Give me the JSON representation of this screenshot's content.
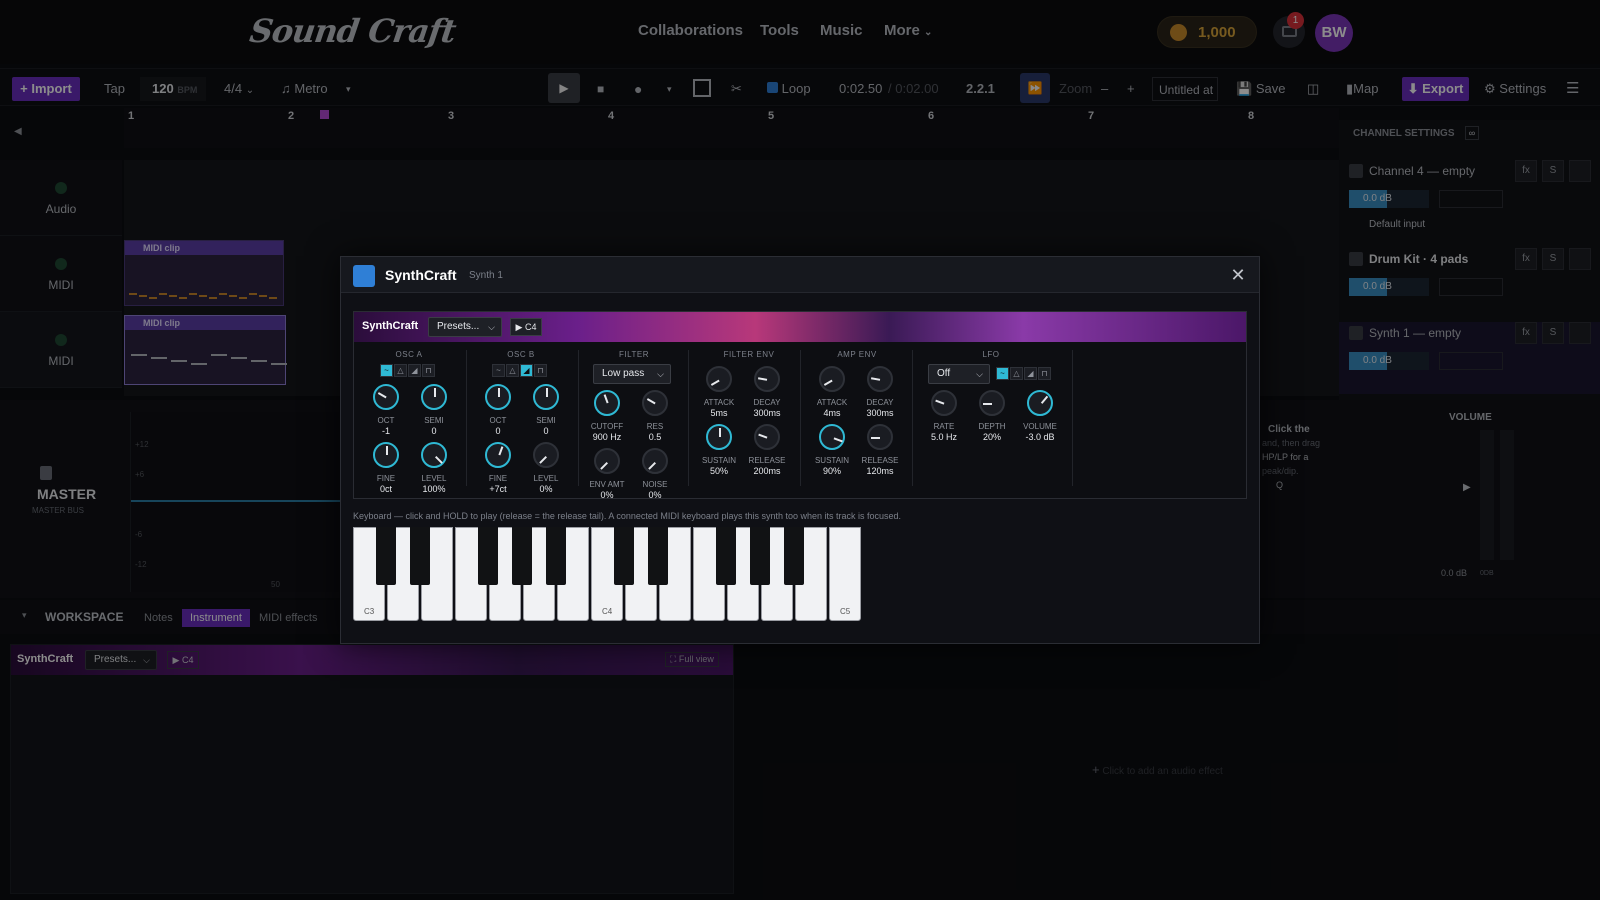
{
  "app": {
    "logo": "Sound Craft"
  },
  "nav": {
    "links": [
      "Collaborations",
      "Tools",
      "Music",
      "More"
    ],
    "more_chevron": "chevron-down-icon"
  },
  "user": {
    "coins": "1,000",
    "notifications": "1",
    "initials": "BW"
  },
  "toolbar": {
    "import": "+ Import",
    "tap": "Tap",
    "bpm": "120",
    "bpm_unit": "BPM",
    "time_sig": "4/4",
    "metro": "Metro",
    "loop": "Loop",
    "position": "0:02.50",
    "duration": "/ 0:02.00",
    "bar_pos": "2.2.1",
    "zoom": "Zoom",
    "zoom_minus": "–",
    "zoom_plus": "+",
    "project_name": "Untitled at",
    "save": "Save",
    "map": "Map",
    "export": "⬇ Export",
    "settings": "Settings"
  },
  "ruler": {
    "bars": [
      "1",
      "2",
      "3",
      "4",
      "5",
      "6",
      "7",
      "8"
    ]
  },
  "tracks": [
    {
      "name": "Audio"
    },
    {
      "name": "MIDI",
      "clip": "MIDI clip"
    },
    {
      "name": "MIDI",
      "clip": "MIDI clip"
    }
  ],
  "channel_settings": {
    "title": "CHANNEL SETTINGS",
    "channels": [
      {
        "name": "Channel 4 — empty",
        "db": "0.0 dB",
        "input": "Default input"
      },
      {
        "name": "Drum Kit · 4 pads",
        "db": "0.0 dB"
      },
      {
        "name": "Synth 1 — empty",
        "db": "0.0 dB"
      }
    ],
    "fx": "fx",
    "solo": "S",
    "colors": {
      "db_fill": "#3a8fc4"
    }
  },
  "master": {
    "name": "MASTER",
    "sub": "MASTER BUS",
    "db_ticks": [
      "+12",
      "+6",
      "0",
      "-6",
      "-12"
    ],
    "ruler_mark": "50",
    "volume_label": "VOLUME",
    "volume_ticks": [
      "+12",
      "+6",
      "0",
      "-6",
      "-12"
    ],
    "volume_db": "0.0 dB",
    "volume_db2": "0DB",
    "hint_title": "Click the",
    "hint_lines": [
      "and, then drag",
      "HP/LP for a",
      "peak/dip.",
      "Q"
    ]
  },
  "workspace": {
    "title": "WORKSPACE",
    "tabs": [
      "Notes",
      "Instrument",
      "MIDI effects"
    ],
    "active_tab": "Instrument",
    "add_effect": "Click to add an audio effect",
    "full_view": "Full view"
  },
  "modal": {
    "title": "SynthCraft",
    "subtitle": "Synth 1",
    "brand": "SynthCraft",
    "presets": "Presets...",
    "play": "▶ C4",
    "sections": {
      "osc_a": "OSC A",
      "osc_b": "OSC B",
      "filter": "FILTER",
      "filter_env": "FILTER ENV",
      "amp_env": "AMP ENV",
      "lfo": "LFO"
    },
    "osc_a": {
      "oct": {
        "label": "OCT",
        "value": "-1"
      },
      "semi": {
        "label": "SEMI",
        "value": "0"
      },
      "fine": {
        "label": "FINE",
        "value": "0ct"
      },
      "level": {
        "label": "LEVEL",
        "value": "100%"
      }
    },
    "osc_b": {
      "oct": {
        "label": "OCT",
        "value": "0"
      },
      "semi": {
        "label": "SEMI",
        "value": "0"
      },
      "fine": {
        "label": "FINE",
        "value": "+7ct"
      },
      "level": {
        "label": "LEVEL",
        "value": "0%"
      }
    },
    "filter": {
      "type": "Low pass",
      "cutoff": {
        "label": "CUTOFF",
        "value": "900 Hz"
      },
      "res": {
        "label": "RES",
        "value": "0.5"
      },
      "env_amt": {
        "label": "ENV AMT",
        "value": "0%"
      },
      "noise": {
        "label": "NOISE",
        "value": "0%"
      }
    },
    "filter_env": {
      "attack": {
        "label": "ATTACK",
        "value": "5ms"
      },
      "decay": {
        "label": "DECAY",
        "value": "300ms"
      },
      "sustain": {
        "label": "SUSTAIN",
        "value": "50%"
      },
      "release": {
        "label": "RELEASE",
        "value": "200ms"
      }
    },
    "amp_env": {
      "attack": {
        "label": "ATTACK",
        "value": "4ms"
      },
      "decay": {
        "label": "DECAY",
        "value": "300ms"
      },
      "sustain": {
        "label": "SUSTAIN",
        "value": "90%"
      },
      "release": {
        "label": "RELEASE",
        "value": "120ms"
      }
    },
    "lfo": {
      "target": "Off",
      "rate": {
        "label": "RATE",
        "value": "5.0 Hz"
      },
      "depth": {
        "label": "DEPTH",
        "value": "20%"
      },
      "volume": {
        "label": "VOLUME",
        "value": "-3.0 dB"
      }
    },
    "keyboard_hint": "Keyboard — click and HOLD to play (release = the release tail). A connected MIDI keyboard plays this synth too when its track is focused.",
    "key_labels": {
      "c3": "C3",
      "c4": "C4",
      "c5": "C5"
    }
  },
  "colors": {
    "accent": "#6a2fc0",
    "knob_cyan": "#2fb9d4",
    "bg": "#0c0d11"
  }
}
